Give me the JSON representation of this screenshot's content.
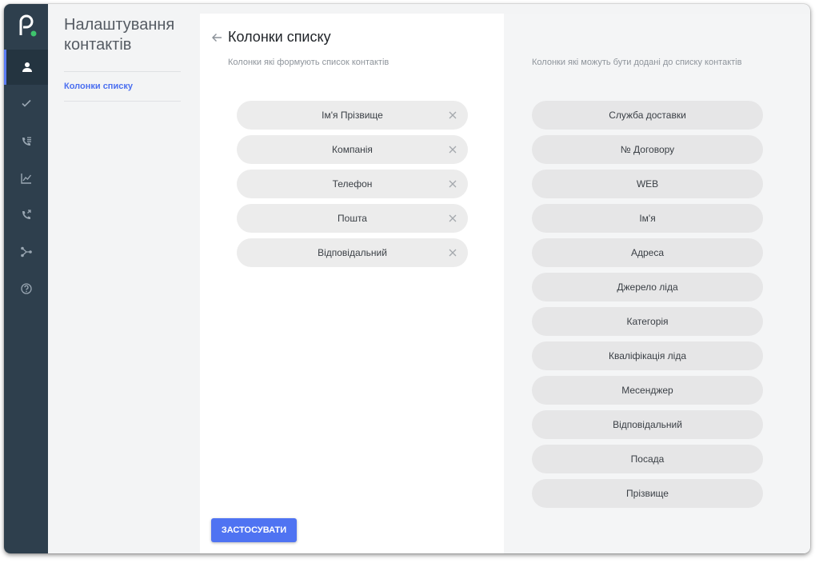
{
  "sidebar": {
    "title": "Налаштування контактів",
    "link": "Колонки списку"
  },
  "rail": {
    "icons": [
      "logo-icon",
      "contacts-icon",
      "check-icon",
      "call-list-icon",
      "chart-icon",
      "phone-icon",
      "flow-icon",
      "help-icon"
    ]
  },
  "panel": {
    "title": "Колонки списку",
    "subtitle": "Колонки які формують список контактів",
    "selected": [
      "Ім'я Прізвище",
      "Компанія",
      "Телефон",
      "Пошта",
      "Відповідальний"
    ],
    "apply_label": "ЗАСТОСУВАТИ"
  },
  "available": {
    "subtitle": "Колонки які можуть бути додані до списку контактів",
    "items": [
      "Служба доставки",
      "№ Договору",
      "WEB",
      "Ім'я",
      "Адреса",
      "Джерело ліда",
      "Категорія",
      "Кваліфікація ліда",
      "Месенджер",
      "Відповідальний",
      "Посада",
      "Прізвище"
    ]
  },
  "colors": {
    "rail": "#2e3f4d",
    "accent": "#4f73f2",
    "logo_dot": "#3ec46d"
  }
}
